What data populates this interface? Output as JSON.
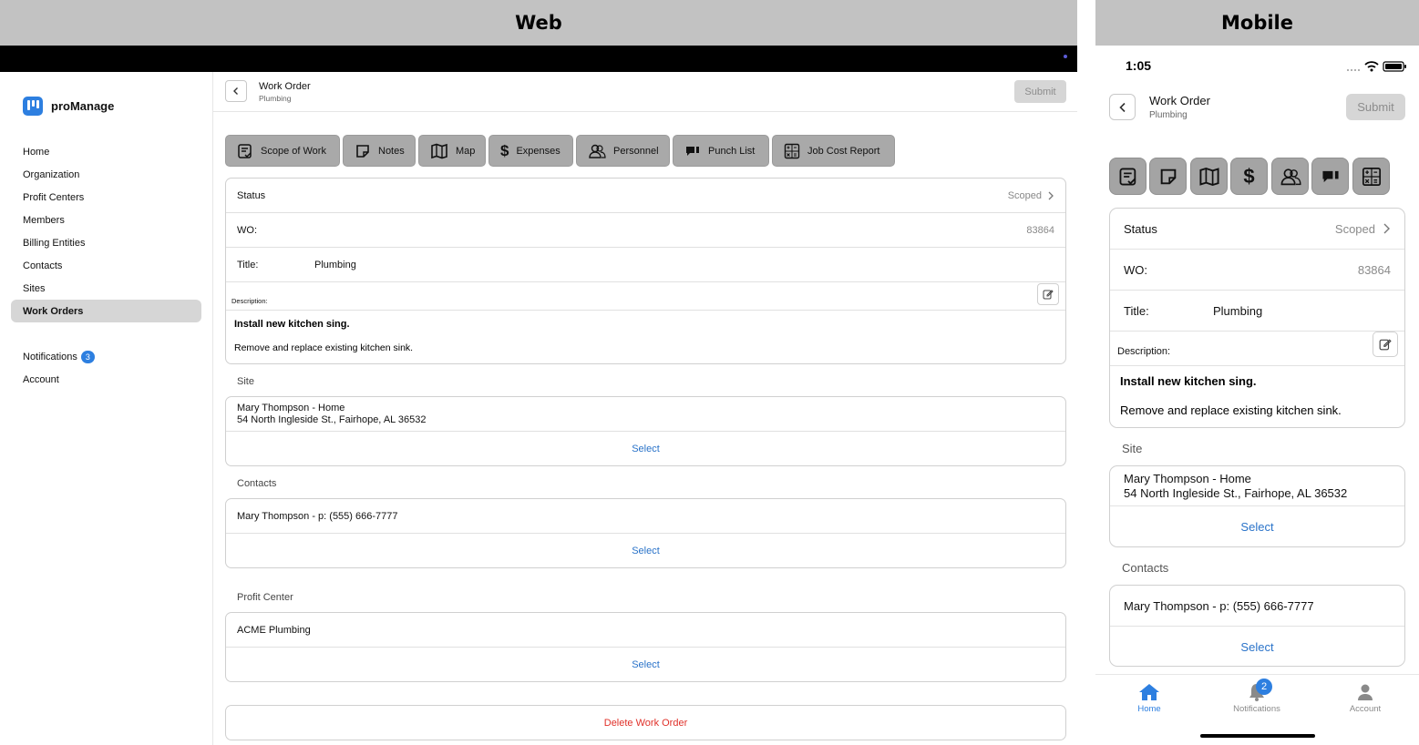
{
  "panels": {
    "web_label": "Web",
    "mobile_label": "Mobile"
  },
  "brand": {
    "name": "proManage"
  },
  "sidebar": {
    "items": [
      {
        "label": "Home"
      },
      {
        "label": "Organization"
      },
      {
        "label": "Profit Centers"
      },
      {
        "label": "Members"
      },
      {
        "label": "Billing Entities"
      },
      {
        "label": "Contacts"
      },
      {
        "label": "Sites"
      },
      {
        "label": "Work Orders",
        "active": true
      }
    ],
    "notifications_label": "Notifications",
    "notifications_count": "3",
    "account_label": "Account"
  },
  "header": {
    "title": "Work Order",
    "subtitle": "Plumbing",
    "submit_label": "Submit"
  },
  "tabs": [
    {
      "label": "Scope of Work",
      "icon": "scope-of-work-icon"
    },
    {
      "label": "Notes",
      "icon": "notes-icon"
    },
    {
      "label": "Map",
      "icon": "map-icon"
    },
    {
      "label": "Expenses",
      "icon": "expenses-icon"
    },
    {
      "label": "Personnel",
      "icon": "personnel-icon"
    },
    {
      "label": "Punch List",
      "icon": "punch-list-icon"
    },
    {
      "label": "Job Cost Report",
      "icon": "job-cost-report-icon"
    }
  ],
  "details": {
    "status_label": "Status",
    "status_value": "Scoped",
    "wo_label": "WO:",
    "wo_value": "83864",
    "title_label": "Title:",
    "title_value": "Plumbing",
    "description_label": "Description:",
    "description_heading": "Install new kitchen sing.",
    "description_body": "Remove and replace existing kitchen sink."
  },
  "site": {
    "label": "Site",
    "name": "Mary Thompson - Home",
    "address": "54 North Ingleside St., Fairhope, AL 36532",
    "select_label": "Select"
  },
  "contacts": {
    "label": "Contacts",
    "value": "Mary Thompson - p: (555) 666-7777",
    "select_label": "Select"
  },
  "profit_center": {
    "label": "Profit Center",
    "value": "ACME Plumbing",
    "select_label": "Select"
  },
  "delete_label": "Delete Work Order",
  "mobile": {
    "time": "1:05",
    "tabbar": [
      {
        "label": "Home",
        "icon": "home-icon",
        "active": true
      },
      {
        "label": "Notifications",
        "icon": "bell-icon",
        "badge": "2"
      },
      {
        "label": "Account",
        "icon": "person-icon"
      }
    ]
  },
  "colors": {
    "accent": "#2a73c9",
    "danger": "#e0312a",
    "active_nav": "#d6d6d6",
    "tab_button": "#a9a9a9"
  }
}
